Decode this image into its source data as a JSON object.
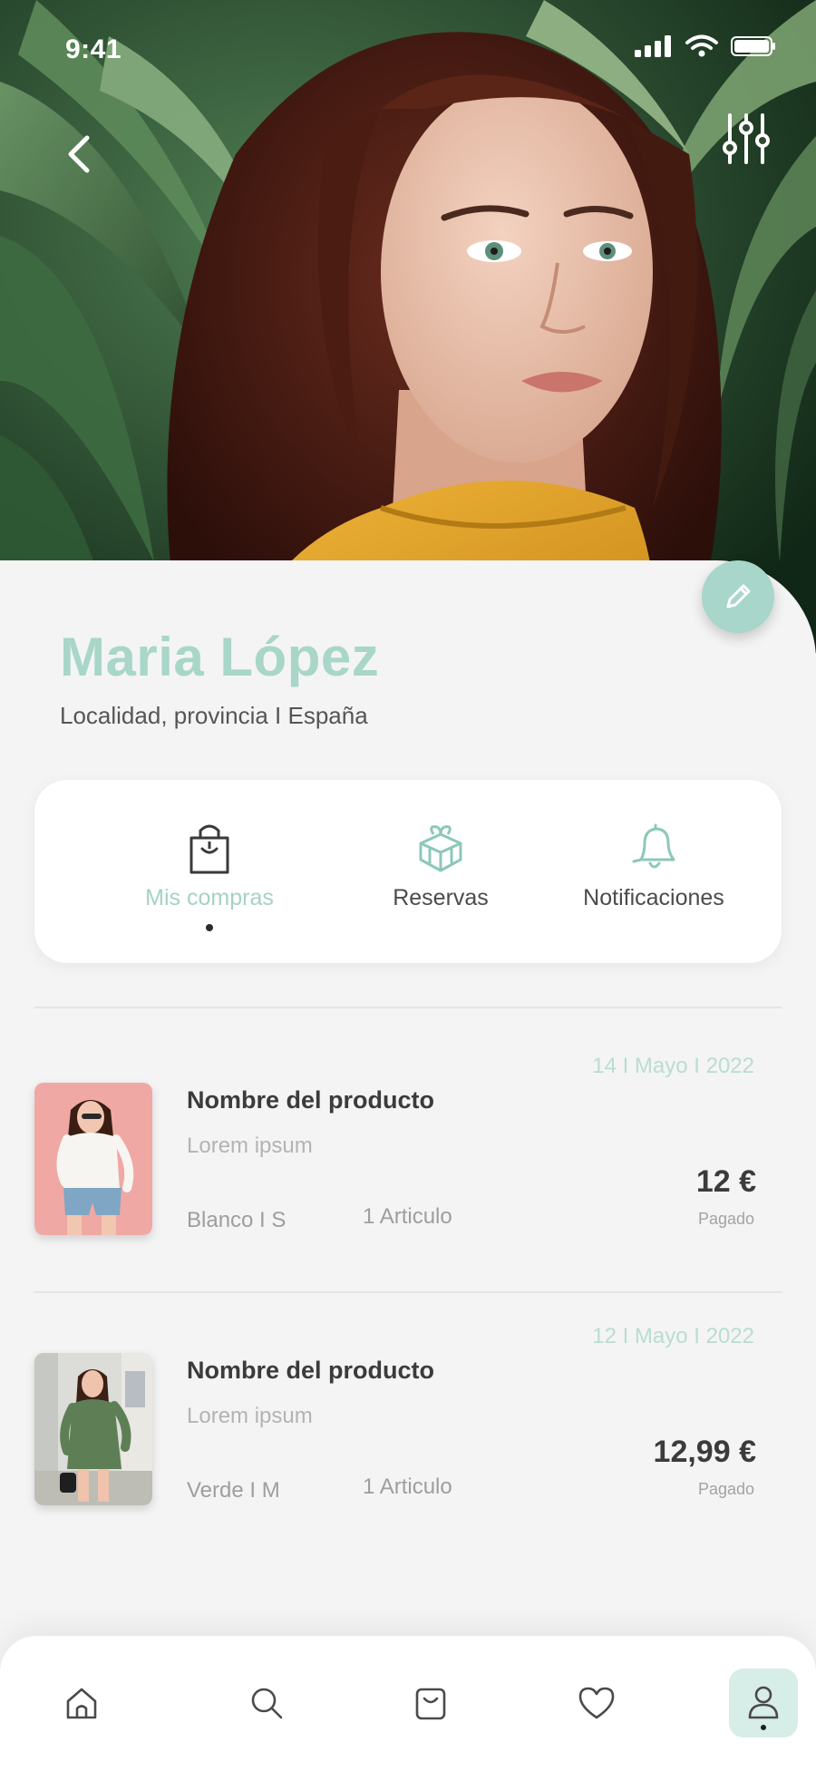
{
  "status_bar": {
    "time": "9:41"
  },
  "header": {
    "back_icon": "chevron-left-icon",
    "filter_icon": "sliders-icon"
  },
  "profile": {
    "name": "Maria López",
    "location": "Localidad, provincia I España",
    "edit_icon": "pencil-icon"
  },
  "tabs": [
    {
      "label": "Mis compras",
      "icon": "shopping-bag-icon",
      "active": true
    },
    {
      "label": "Reservas",
      "icon": "gift-box-icon",
      "active": false
    },
    {
      "label": "Notificaciones",
      "icon": "bell-icon",
      "active": false
    }
  ],
  "orders": [
    {
      "date": "14 I Mayo I 2022",
      "name": "Nombre del producto",
      "description": "Lorem ipsum",
      "variant": "Blanco I S",
      "quantity": "1 Articulo",
      "price": "12 €",
      "status": "Pagado"
    },
    {
      "date": "12 I Mayo I 2022",
      "name": "Nombre del producto",
      "description": "Lorem ipsum",
      "variant": "Verde I M",
      "quantity": "1 Articulo",
      "price": "12,99 €",
      "status": "Pagado"
    }
  ],
  "bottom_nav": [
    {
      "icon": "home-icon",
      "active": false
    },
    {
      "icon": "search-icon",
      "active": false
    },
    {
      "icon": "cart-icon",
      "active": false
    },
    {
      "icon": "heart-icon",
      "active": false
    },
    {
      "icon": "user-icon",
      "active": true
    }
  ],
  "colors": {
    "accent": "#a8d6ca",
    "accent_text": "#a5d2c6",
    "background": "#f4f4f4",
    "hero_thumb_1": "#f0a8a4",
    "hero_thumb_2": "#5c7a55"
  }
}
